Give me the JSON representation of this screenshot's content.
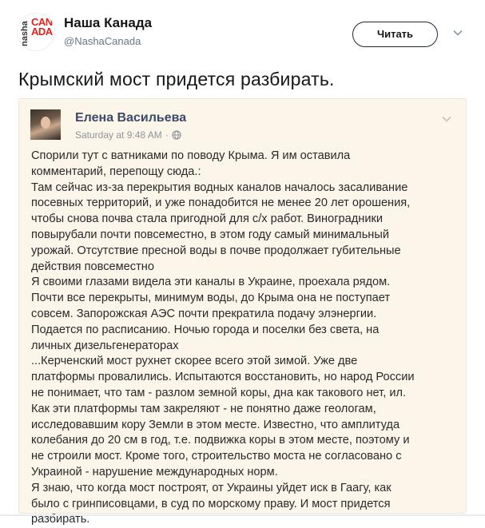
{
  "account": {
    "avatar_side": "nasha",
    "avatar_logo": "CANADA",
    "name": "Наша Канада",
    "handle": "@NashaCanada",
    "follow_label": "Читать"
  },
  "tweet": {
    "text": "Крымский мост придется разбирать."
  },
  "embedded_post": {
    "author": "Елена Васильева",
    "timestamp": "Saturday at 9:48 AM",
    "separator": "·",
    "lines": [
      "Спорили тут с ватниками по поводу Крыма. Я им оставила",
      "комментарий, перепощу сюда.:",
      "  Там сейчас из-за перекрытия водных каналов началось засаливание",
      "посевных территорий, и уже понадобится не менее 20 лет орошения,",
      "чтобы снова почва стала пригодной для с/х работ. Виноградники",
      "повырубали почти повсеместно, в этом году самый минимальный",
      "урожай. Отсутствие пресной воды в почве продолжает губительные",
      "действия повсеместно",
      "Я своими глазами видела эти каналы в Украине, проехала рядом.",
      "  Почти все перекрыты, минимум воды, до Крыма она не поступает",
      "совсем. Запорожская АЭС почти прекратила подачу элэнергии.",
      "Подается по расписанию. Ночью города и поселки без света, на",
      "личных дизельгенераторах",
      "...Керченский мост рухнет скорее всего этой зимой. Уже две",
      "платформы провалились. Испытаются восстановить, но народ России",
      "не понимает, что там - разлом земной коры, дна как такового нет, ил.",
      "Как эти платформы там закреляют - не понятно даже геологам,",
      "исследовавшим кору Земли в этом месте. Известно, что амплитуда",
      "колебания до 20 см в год, т.е. подвижка коры в этом месте, поэтому и",
      "не строили мост. Кроме того, строительство моста не согласовано с",
      "Украиной - нарушение международных норм.",
      "Я знаю, что когда мост построят, от Украины уйдет иск в Гаагу, как",
      "было с гринписовцами, в суд по морскому праву. И мост придется",
      "разбирать."
    ]
  },
  "colors": {
    "card_bg": "#fbf5ea",
    "link_blue": "#3b4a6a",
    "muted": "#657786"
  },
  "icons": {
    "header_menu": "chevron-down-icon",
    "post_menu": "chevron-down-icon",
    "privacy": "globe-icon"
  }
}
